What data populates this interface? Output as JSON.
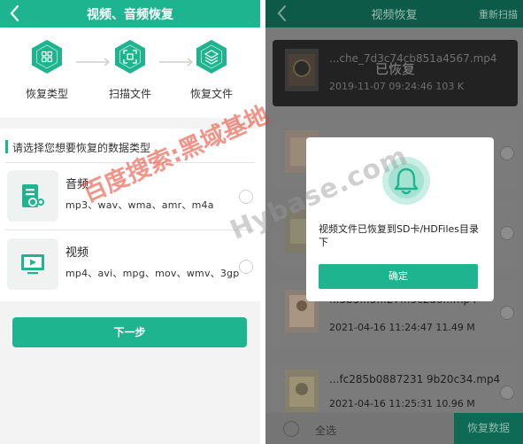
{
  "left": {
    "header": {
      "title": "视频、音频恢复"
    },
    "steps": [
      {
        "label": "恢复类型"
      },
      {
        "label": "扫描文件"
      },
      {
        "label": "恢复文件"
      }
    ],
    "prompt": "请选择您想要恢复的数据类型",
    "types": [
      {
        "name": "音频",
        "extensions": "mp3、wav、wma、amr、m4a"
      },
      {
        "name": "视频",
        "extensions": "mp4、avi、mpg、mov、wmv、3gp"
      }
    ],
    "next_label": "下一步"
  },
  "right": {
    "header": {
      "title": "视频恢复",
      "rescan": "重新扫描"
    },
    "files": [
      {
        "name": "...che_7d3c74cb851a4567.mp4",
        "meta": "2019-11-07 09:24:46   103 K",
        "overlay": "已恢复"
      },
      {
        "name": "",
        "meta": ""
      },
      {
        "name": "",
        "meta": ""
      },
      {
        "name": "...5b5...5...27...5c2a6...mp4",
        "meta": "2021-04-16 11:24:47   11.49 M"
      },
      {
        "name": "...fc285b0887231 9b20c34.mp4",
        "meta": "2021-04-16 11:25:31   10.96 M"
      }
    ],
    "dialog": {
      "message": "视频文件已恢复到SD卡/HDFiles目录下",
      "ok_label": "确定"
    },
    "bottom": {
      "select_all": "全选",
      "recover": "恢复数据"
    }
  },
  "watermark": {
    "cn": "百度搜索:黑域基地",
    "en": "Hybase.com"
  },
  "colors": {
    "accent": "#1db48f",
    "dark_accent": "#0e5a48"
  }
}
